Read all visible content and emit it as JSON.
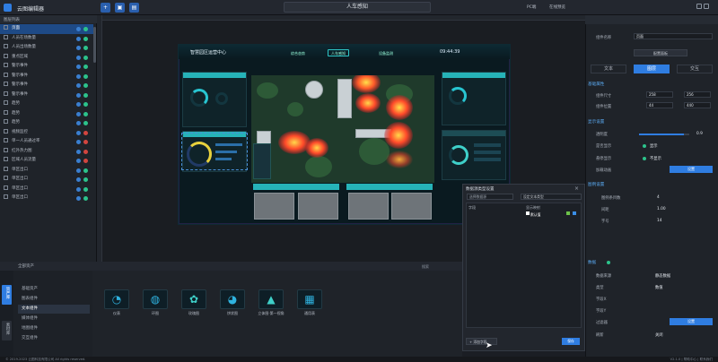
{
  "header": {
    "app_title": "云图编辑器",
    "doc_title": "人车感知",
    "quality_label": "PC端",
    "preview_label": "在线预览"
  },
  "layers": {
    "header_label": "图层列表",
    "items": [
      {
        "label": "页面"
      },
      {
        "label": "人员在场数量"
      },
      {
        "label": "人员出场数量"
      },
      {
        "label": "重点区域"
      },
      {
        "label": "警示事件"
      },
      {
        "label": "警示事件"
      },
      {
        "label": "警示事件"
      },
      {
        "label": "警示事件"
      },
      {
        "label": "趋势"
      },
      {
        "label": "趋势"
      },
      {
        "label": "趋势"
      },
      {
        "label": "视频监控"
      },
      {
        "label": "单一人员通过率"
      },
      {
        "label": "红外热力图"
      },
      {
        "label": "区域人员流量"
      },
      {
        "label": "单区出口"
      },
      {
        "label": "单区出口"
      },
      {
        "label": "单区出口"
      },
      {
        "label": "单区出口"
      }
    ]
  },
  "dashboard": {
    "title": "智慧园区运营中心",
    "tabs": [
      "综合态势",
      "人车感知",
      "设备监测"
    ],
    "time": "09:44:39"
  },
  "assets": {
    "toolbar_label": "全部资产",
    "search_placeholder": "搜索",
    "side_tabs": [
      "资产库",
      "素材库"
    ],
    "tree": [
      "基础资产",
      "图表组件",
      "文本组件",
      "媒体组件",
      "地图组件",
      "交互组件"
    ],
    "thumbs": [
      "仪表",
      "环图",
      "玫瑰图",
      "饼状图",
      "立体图·第一视角",
      "通用表"
    ]
  },
  "dialog": {
    "title": "数据源类型设置",
    "search_placeholder": "选择数据源",
    "dropdown_value": "设定文本类型",
    "col1": "字段",
    "col2": "显示映射",
    "row_value": "默认值",
    "add_button": "+ 添加字段",
    "ok_button": "保存"
  },
  "props": {
    "tabs": [
      "文本",
      "图层",
      "交互"
    ],
    "name_label": "组件名称",
    "name_value": "页面",
    "style_button": "配置面板",
    "section_basic": "基础属性",
    "size_label": "组件尺寸",
    "width": "258",
    "height": "256",
    "pos_label": "组件位置",
    "x": "44",
    "y": "440",
    "section_display": "显示设置",
    "opacity_label": "透明度",
    "opacity": "0.9",
    "show_label": "是否显示",
    "show_value": "显示",
    "hover_label": "悬停显示",
    "hover_value": "不显示",
    "anim_label": "加载动画",
    "anim_button": "设置",
    "section_legend": "图例设置",
    "legend_count_label": "图例条目数",
    "legend_count": "4",
    "legend_gap_label": "间距",
    "legend_gap": "1.00",
    "legend_font_label": "字号",
    "legend_font": "14",
    "section_data": "数据",
    "data_src_label": "数据来源",
    "data_src": "静态数据",
    "data_type_label": "类型",
    "data_type": "数值",
    "field1_label": "字段X",
    "field2_label": "字段Y",
    "filter_label": "过滤器",
    "filter_button": "设置",
    "refresh_label": "刷新",
    "refresh_value": "关闭"
  },
  "status": {
    "left": "© 2019-2023 云图科技有限公司 All rights reserved.",
    "right": "V2.1.0  |  帮助中心  |  联系我们"
  }
}
